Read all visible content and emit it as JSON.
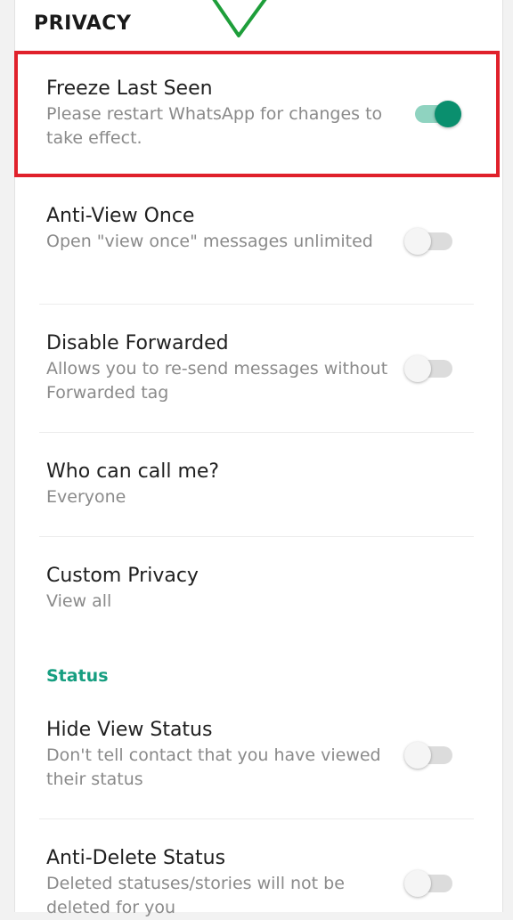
{
  "header": {
    "section_title": "PRIVACY"
  },
  "settings": [
    {
      "title": "Freeze Last Seen",
      "subtitle": "Please restart WhatsApp for changes to take effect.",
      "toggle_on": true
    },
    {
      "title": "Anti-View Once",
      "subtitle": "Open \"view once\" messages unlimited",
      "toggle_on": false
    },
    {
      "title": "Disable Forwarded",
      "subtitle": "Allows you to re-send messages without Forwarded tag",
      "toggle_on": false
    },
    {
      "title": "Who can call me?",
      "subtitle": "Everyone"
    },
    {
      "title": "Custom Privacy",
      "subtitle": "View all"
    }
  ],
  "status_section": {
    "header": "Status",
    "items": [
      {
        "title": "Hide View Status",
        "subtitle": "Don't tell contact that you have viewed their status",
        "toggle_on": false
      },
      {
        "title": "Anti-Delete Status",
        "subtitle": "Deleted statuses/stories will not be deleted for you",
        "toggle_on": false
      }
    ]
  },
  "colors": {
    "accent": "#169e80",
    "toggle_on_thumb": "#0a8f6e",
    "toggle_on_track": "#8fd3c0",
    "highlight_border": "#e0212b",
    "check_mark": "#1e9e3a"
  },
  "icons": {
    "annotation": "check-mark-icon"
  }
}
